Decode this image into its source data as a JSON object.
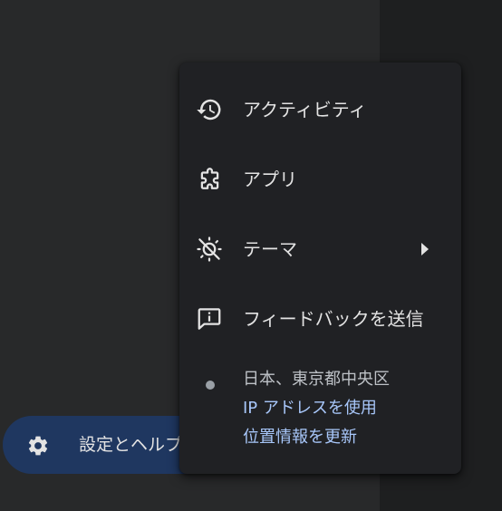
{
  "sidebar": {
    "settings_label": "設定とヘルプ"
  },
  "menu": {
    "items": [
      {
        "label": "アクティビティ",
        "icon": "history-icon"
      },
      {
        "label": "アプリ",
        "icon": "extension-icon"
      },
      {
        "label": "テーマ",
        "icon": "theme-icon"
      },
      {
        "label": "フィードバックを送信",
        "icon": "feedback-icon"
      }
    ]
  },
  "location": {
    "place": "日本、東京都中央区",
    "use_ip_label": "IP アドレスを使用",
    "update_location_label": "位置情報を更新"
  },
  "colors": {
    "menu_bg": "#202124",
    "sidebar_bg": "#28292a",
    "pill_bg": "#1f3760",
    "link": "#a8c7fa",
    "text": "#e3e3e3"
  }
}
